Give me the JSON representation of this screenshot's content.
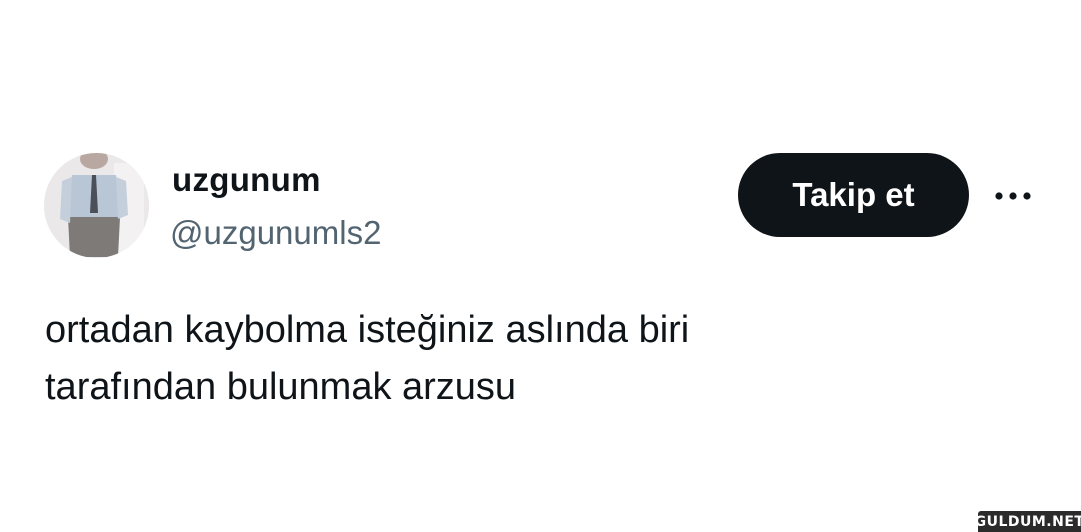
{
  "user": {
    "display_name": "uzgunum",
    "handle": "@uzgunumls2"
  },
  "actions": {
    "follow_label": "Takip et",
    "more_icon": "more-horizontal-icon"
  },
  "tweet": {
    "line1": "ortadan kaybolma isteğiniz aslında biri",
    "line2": "tarafından bulunmak arzusu"
  },
  "watermark": {
    "text": "GULDUM.NET"
  },
  "colors": {
    "text_primary": "#0f1419",
    "text_secondary": "#536471",
    "button_bg": "#0f1419",
    "button_text": "#ffffff",
    "background": "#ffffff"
  }
}
